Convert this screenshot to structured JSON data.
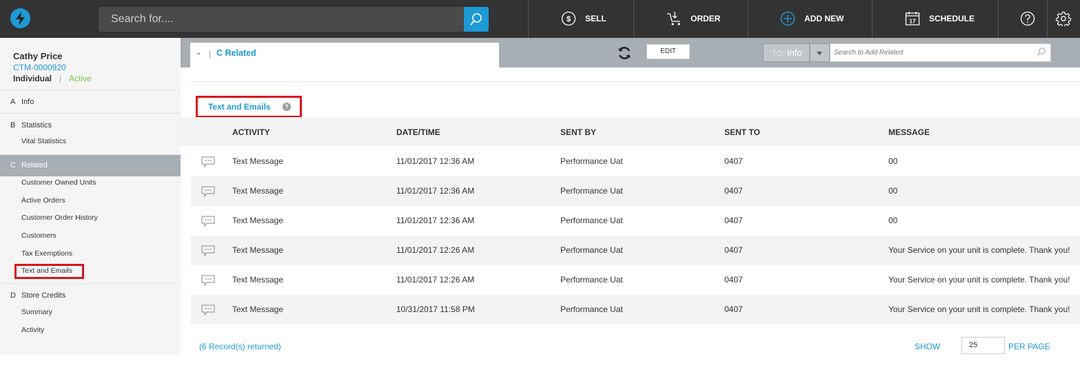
{
  "topbar": {
    "search_placeholder": "Search for....",
    "nav": [
      {
        "label": "SELL",
        "icon": "dollar-circle-icon"
      },
      {
        "label": "ORDER",
        "icon": "cart-icon"
      },
      {
        "label": "ADD NEW",
        "icon": "plus-circle-icon"
      },
      {
        "label": "SCHEDULE",
        "icon": "calendar-icon"
      }
    ],
    "calendar_day": "17",
    "icons": [
      "help-icon",
      "gear-icon"
    ],
    "accent_color": "#1e9ad6"
  },
  "customer": {
    "name": "Cathy Price",
    "id": "CTM-0000920",
    "type": "Individual",
    "separator": "|",
    "status": "Active"
  },
  "sidebar": {
    "sections": [
      {
        "letter": "A",
        "label": "Info",
        "items": []
      },
      {
        "letter": "B",
        "label": "Statistics",
        "items": [
          "Vital Statistics"
        ]
      },
      {
        "letter": "C",
        "label": "Related",
        "items": [
          "Customer Owned Units",
          "Active Orders",
          "Customer Order History",
          "Customers",
          "Tax Exemptions",
          "Text and Emails"
        ]
      },
      {
        "letter": "D",
        "label": "Store Credits",
        "items": [
          "Summary",
          "Activity"
        ]
      }
    ]
  },
  "header": {
    "breadcrumb": "C Related",
    "edit_label": "EDIT",
    "to_prefix": "TO:",
    "to_value": "Info",
    "search_placeholder": "Search to Add Related"
  },
  "section": {
    "title": "Text and Emails",
    "help": "?"
  },
  "table": {
    "columns": [
      "ACTIVITY",
      "DATE/TIME",
      "SENT BY",
      "SENT TO",
      "MESSAGE"
    ],
    "rows": [
      {
        "activity": "Text Message",
        "datetime": "11/01/2017 12:36 AM",
        "sent_by": "Performance Uat",
        "sent_to": "0407",
        "message": "00"
      },
      {
        "activity": "Text Message",
        "datetime": "11/01/2017 12:36 AM",
        "sent_by": "Performance Uat",
        "sent_to": "0407",
        "message": "00"
      },
      {
        "activity": "Text Message",
        "datetime": "11/01/2017 12:36 AM",
        "sent_by": "Performance Uat",
        "sent_to": "0407",
        "message": "00"
      },
      {
        "activity": "Text Message",
        "datetime": "11/01/2017 12:26 AM",
        "sent_by": "Performance Uat",
        "sent_to": "0407",
        "message": "Your Service on your unit is complete. Thank you!"
      },
      {
        "activity": "Text Message",
        "datetime": "11/01/2017 12:26 AM",
        "sent_by": "Performance Uat",
        "sent_to": "0407",
        "message": "Your Service on your unit is complete. Thank you!"
      },
      {
        "activity": "Text Message",
        "datetime": "10/31/2017 11:58 PM",
        "sent_by": "Performance Uat",
        "sent_to": "0407",
        "message": "Your Service on your unit is complete. Thank you!"
      }
    ]
  },
  "footer": {
    "records": "(6 Record(s) returned)",
    "show": "SHOW",
    "per_page_value": "25",
    "per_page": "PER PAGE"
  }
}
